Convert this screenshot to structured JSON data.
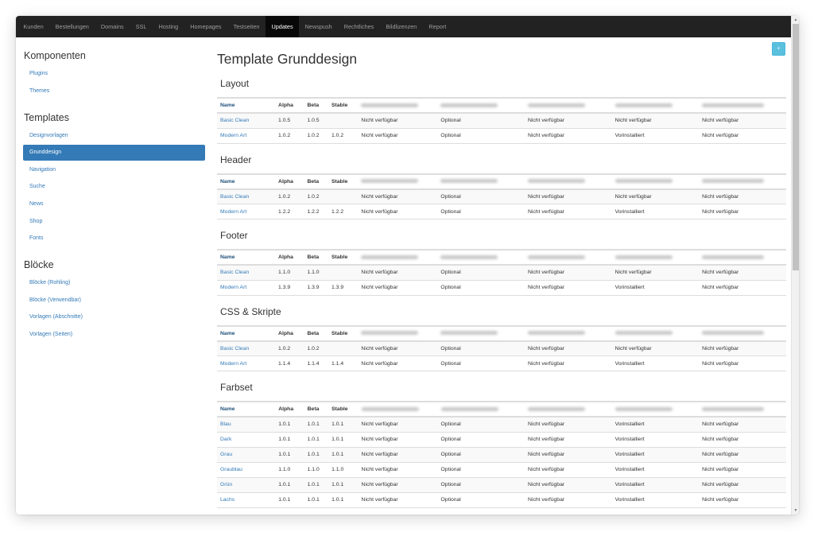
{
  "nav": {
    "items": [
      "Kunden",
      "Bestellungen",
      "Domains",
      "SSL",
      "Hosting",
      "Homepages",
      "Testseiten",
      "Updates",
      "Newspush",
      "Rechtliches",
      "Bildlizenzen",
      "Report"
    ],
    "active": "Updates"
  },
  "sidebar": {
    "groups": [
      {
        "title": "Komponenten",
        "items": [
          "Plugins",
          "Themes"
        ]
      },
      {
        "title": "Templates",
        "items": [
          "Designvorlagen",
          "Grunddesign",
          "Navigation",
          "Suche",
          "News",
          "Shop",
          "Fonts"
        ]
      },
      {
        "title": "Blöcke",
        "items": [
          "Blöcke (Rohling)",
          "Blöcke (Verwendbar)",
          "Vorlagen (Abschnitte)",
          "Vorlagen (Seiten)"
        ]
      }
    ],
    "active": "Grunddesign"
  },
  "main": {
    "title": "Template Grunddesign",
    "add_button_icon": "plus-icon",
    "columns": [
      "Name",
      "Alpha",
      "Beta",
      "Stable"
    ],
    "blurred_column_count": 5,
    "sections": [
      {
        "title": "Layout",
        "rows": [
          {
            "name": "Basic Clean",
            "alpha": "1.0.5",
            "beta": "1.0.5",
            "stable": "",
            "status": [
              "Nicht verfügbar",
              "Optional",
              "Nicht verfügbar",
              "Nicht verfügbar",
              "Nicht verfügbar"
            ]
          },
          {
            "name": "Modern Art",
            "alpha": "1.0.2",
            "beta": "1.0.2",
            "stable": "1.0.2",
            "status": [
              "Nicht verfügbar",
              "Optional",
              "Nicht verfügbar",
              "Vorinstalliert",
              "Nicht verfügbar"
            ]
          }
        ]
      },
      {
        "title": "Header",
        "rows": [
          {
            "name": "Basic Clean",
            "alpha": "1.0.2",
            "beta": "1.0.2",
            "stable": "",
            "status": [
              "Nicht verfügbar",
              "Optional",
              "Nicht verfügbar",
              "Nicht verfügbar",
              "Nicht verfügbar"
            ]
          },
          {
            "name": "Modern Art",
            "alpha": "1.2.2",
            "beta": "1.2.2",
            "stable": "1.2.2",
            "status": [
              "Nicht verfügbar",
              "Optional",
              "Nicht verfügbar",
              "Vorinstalliert",
              "Nicht verfügbar"
            ]
          }
        ]
      },
      {
        "title": "Footer",
        "rows": [
          {
            "name": "Basic Clean",
            "alpha": "1.1.0",
            "beta": "1.1.0",
            "stable": "",
            "status": [
              "Nicht verfügbar",
              "Optional",
              "Nicht verfügbar",
              "Nicht verfügbar",
              "Nicht verfügbar"
            ]
          },
          {
            "name": "Modern Art",
            "alpha": "1.3.9",
            "beta": "1.3.9",
            "stable": "1.3.9",
            "status": [
              "Nicht verfügbar",
              "Optional",
              "Nicht verfügbar",
              "Vorinstalliert",
              "Nicht verfügbar"
            ]
          }
        ]
      },
      {
        "title": "CSS & Skripte",
        "rows": [
          {
            "name": "Basic Clean",
            "alpha": "1.0.2",
            "beta": "1.0.2",
            "stable": "",
            "status": [
              "Nicht verfügbar",
              "Optional",
              "Nicht verfügbar",
              "Nicht verfügbar",
              "Nicht verfügbar"
            ]
          },
          {
            "name": "Modern Art",
            "alpha": "1.1.4",
            "beta": "1.1.4",
            "stable": "1.1.4",
            "status": [
              "Nicht verfügbar",
              "Optional",
              "Nicht verfügbar",
              "Vorinstalliert",
              "Nicht verfügbar"
            ]
          }
        ]
      },
      {
        "title": "Farbset",
        "rows": [
          {
            "name": "Blau",
            "alpha": "1.0.1",
            "beta": "1.0.1",
            "stable": "1.0.1",
            "status": [
              "Nicht verfügbar",
              "Optional",
              "Nicht verfügbar",
              "Vorinstalliert",
              "Nicht verfügbar"
            ]
          },
          {
            "name": "Dark",
            "alpha": "1.0.1",
            "beta": "1.0.1",
            "stable": "1.0.1",
            "status": [
              "Nicht verfügbar",
              "Optional",
              "Nicht verfügbar",
              "Vorinstalliert",
              "Nicht verfügbar"
            ]
          },
          {
            "name": "Grau",
            "alpha": "1.0.1",
            "beta": "1.0.1",
            "stable": "1.0.1",
            "status": [
              "Nicht verfügbar",
              "Optional",
              "Nicht verfügbar",
              "Vorinstalliert",
              "Nicht verfügbar"
            ]
          },
          {
            "name": "Graublau",
            "alpha": "1.1.0",
            "beta": "1.1.0",
            "stable": "1.1.0",
            "status": [
              "Nicht verfügbar",
              "Optional",
              "Nicht verfügbar",
              "Vorinstalliert",
              "Nicht verfügbar"
            ]
          },
          {
            "name": "Grün",
            "alpha": "1.0.1",
            "beta": "1.0.1",
            "stable": "1.0.1",
            "status": [
              "Nicht verfügbar",
              "Optional",
              "Nicht verfügbar",
              "Vorinstalliert",
              "Nicht verfügbar"
            ]
          },
          {
            "name": "Lachs",
            "alpha": "1.0.1",
            "beta": "1.0.1",
            "stable": "1.0.1",
            "status": [
              "Nicht verfügbar",
              "Optional",
              "Nicht verfügbar",
              "Vorinstalliert",
              "Nicht verfügbar"
            ]
          }
        ]
      }
    ]
  },
  "colors": {
    "navbar": "#222222",
    "nav_active": "#080808",
    "link": "#337ab7",
    "sidebar_active": "#337ab7",
    "add_button": "#5bc0de"
  }
}
